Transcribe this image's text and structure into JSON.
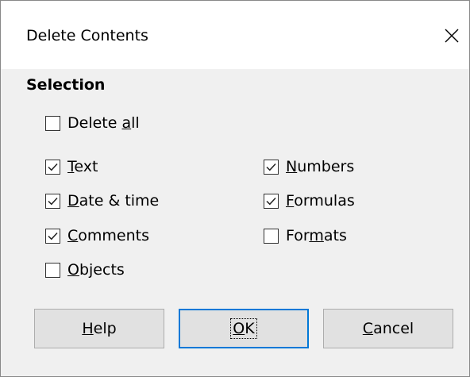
{
  "dialog": {
    "title": "Delete Contents"
  },
  "section": {
    "title": "Selection"
  },
  "checkboxes": {
    "delete_all": {
      "pre": "Delete ",
      "key": "a",
      "post": "ll",
      "checked": false
    },
    "text": {
      "pre": "",
      "key": "T",
      "post": "ext",
      "checked": true
    },
    "date_time": {
      "pre": "",
      "key": "D",
      "post": "ate & time",
      "checked": true
    },
    "comments": {
      "pre": "",
      "key": "C",
      "post": "omments",
      "checked": true
    },
    "objects": {
      "pre": "",
      "key": "O",
      "post": "bjects",
      "checked": false
    },
    "numbers": {
      "pre": "",
      "key": "N",
      "post": "umbers",
      "checked": true
    },
    "formulas": {
      "pre": "",
      "key": "F",
      "post": "ormulas",
      "checked": true
    },
    "formats": {
      "pre": "For",
      "key": "m",
      "post": "ats",
      "checked": false
    }
  },
  "buttons": {
    "help": {
      "pre": "",
      "key": "H",
      "post": "elp"
    },
    "ok": {
      "pre": "",
      "key": "O",
      "post": "K"
    },
    "cancel": {
      "pre": "",
      "key": "C",
      "post": "ancel"
    }
  },
  "colors": {
    "content_bg": "#f0f0f0",
    "button_bg": "#e1e1e1",
    "default_button_border": "#0078d7"
  },
  "icons": {
    "close": "close-icon",
    "check": "checkmark-icon"
  }
}
